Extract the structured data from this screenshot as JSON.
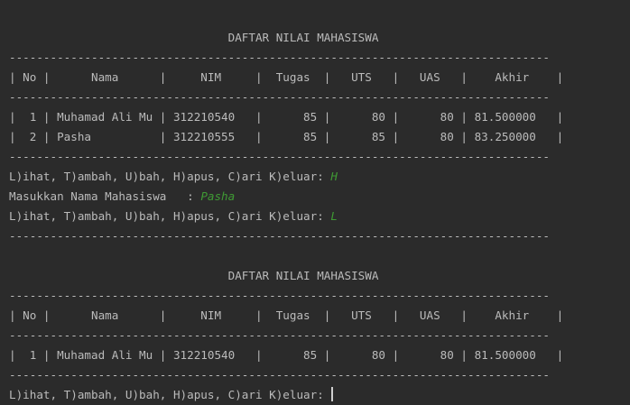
{
  "console": {
    "lines": [
      {
        "text": ""
      },
      {
        "text": "                                DAFTAR NILAI MAHASISWA"
      },
      {
        "text": "-------------------------------------------------------------------------------"
      },
      {
        "text": "| No |      Nama      |     NIM     |  Tugas  |   UTS   |   UAS   |    Akhir    |"
      },
      {
        "text": "-------------------------------------------------------------------------------"
      },
      {
        "text": "|  1 | Muhamad Ali Mu | 312210540   |      85 |      80 |      80 | 81.500000   |"
      },
      {
        "text": "|  2 | Pasha          | 312210555   |      85 |      85 |      80 | 83.250000   |"
      },
      {
        "text": "-------------------------------------------------------------------------------"
      },
      {
        "text": "L)ihat, T)ambah, U)bah, H)apus, C)ari K)eluar: ",
        "input": "H"
      },
      {
        "text": "Masukkan Nama Mahasiswa   : ",
        "input": "Pasha"
      },
      {
        "text": "L)ihat, T)ambah, U)bah, H)apus, C)ari K)eluar: ",
        "input": "L"
      },
      {
        "text": "-------------------------------------------------------------------------------"
      },
      {
        "text": ""
      },
      {
        "text": "                                DAFTAR NILAI MAHASISWA"
      },
      {
        "text": "-------------------------------------------------------------------------------"
      },
      {
        "text": "| No |      Nama      |     NIM     |  Tugas  |   UTS   |   UAS   |    Akhir    |"
      },
      {
        "text": "-------------------------------------------------------------------------------"
      },
      {
        "text": "|  1 | Muhamad Ali Mu | 312210540   |      85 |      80 |      80 | 81.500000   |"
      },
      {
        "text": "-------------------------------------------------------------------------------"
      },
      {
        "text": "L)ihat, T)ambah, U)bah, H)apus, C)ari K)eluar: ",
        "cursor": true
      }
    ]
  },
  "colors": {
    "background": "#2b2b2b",
    "text": "#bbbbbb",
    "user_input": "#3f9a34"
  }
}
